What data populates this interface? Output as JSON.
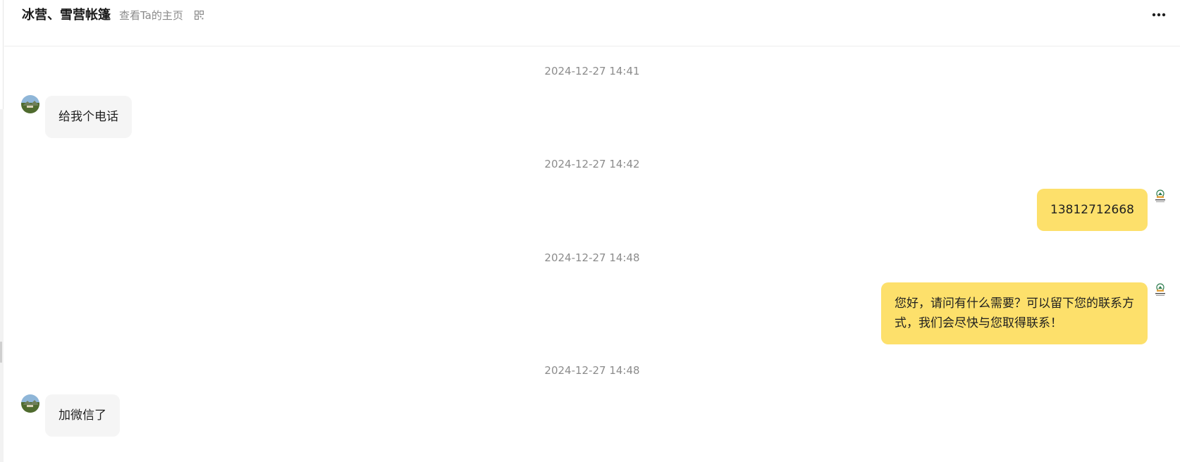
{
  "header": {
    "title": "冰营、雪营帐篷",
    "profile_link": "查看Ta的主页",
    "qr_icon": "qr-code-icon",
    "more_icon": "more-horizontal-icon"
  },
  "messages": [
    {
      "timestamp": "2024-12-27 14:41",
      "direction": "incoming",
      "text": "给我个电话"
    },
    {
      "timestamp": "2024-12-27 14:42",
      "direction": "outgoing",
      "text": "13812712668"
    },
    {
      "timestamp": "2024-12-27 14:48",
      "direction": "outgoing",
      "lines": [
        "您好，请问有什么需要？可以留下您的联系方",
        "式，我们会尽快与您取得联系！"
      ]
    },
    {
      "timestamp": "2024-12-27 14:48",
      "direction": "incoming",
      "text": "加微信了"
    }
  ],
  "colors": {
    "outgoing_bubble": "#fde06b",
    "incoming_bubble": "#f5f5f5",
    "timestamp": "#8c8c8c"
  }
}
